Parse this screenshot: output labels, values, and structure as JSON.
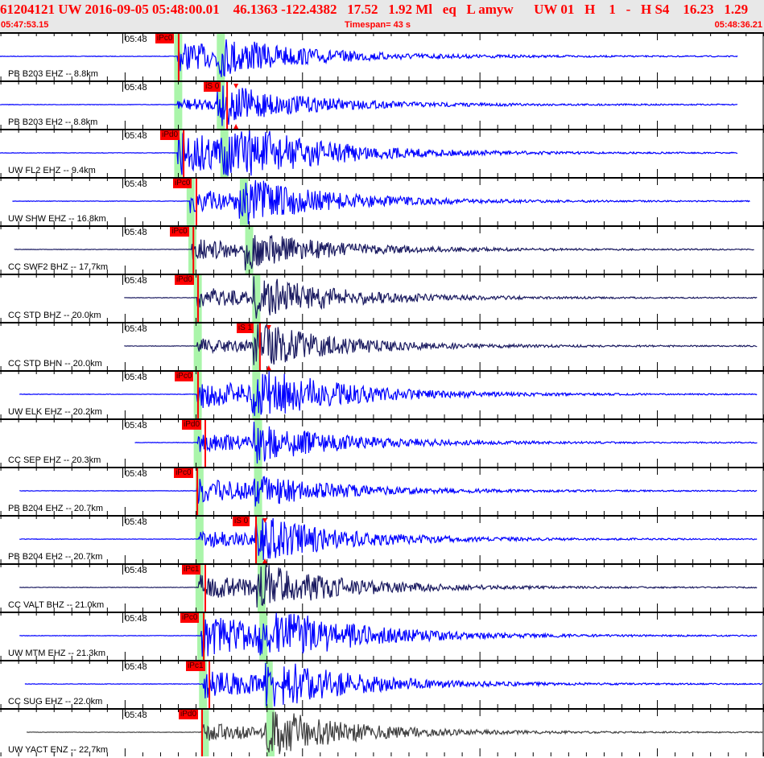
{
  "header": {
    "title": "61204121 UW 2016-09-05 05:48:00.01    46.1363 -122.4382   17.52   1.92 Ml   eq   L amyw      UW 01   H    1   -   H S4    16.23   1.29",
    "start_time": "05:47:53.15",
    "timespan": "Timespan=  43 s",
    "end_time": "05:48:36.21"
  },
  "axis": {
    "window_start_s": 0,
    "window_length_s": 43.06,
    "minute_label": "05:48",
    "minute_label_time_s": 6.9
  },
  "colors": {
    "header_text": "#ff0000",
    "pick": "#ff0000",
    "predicted_band": "#aaf5aa",
    "blue": "#0000ff",
    "navy": "#1a1a60",
    "gray": "#404040"
  },
  "traces": [
    {
      "label": "PB B203 EHZ -- 8.8km",
      "pick": "iPc0",
      "pick_s": 10.07,
      "p_band_s": 10.0,
      "s_band_s": 12.4,
      "data_start_s": 0,
      "data_end_s": 41.6,
      "color": "blue",
      "amp": 0.6,
      "s_amp": 0.5
    },
    {
      "label": "PB B203 EH2 -- 8.8km",
      "pick": "iS 0",
      "pick_s": 12.8,
      "p_band_s": 10.0,
      "s_band_s": 12.4,
      "data_start_s": 0,
      "data_end_s": 41.6,
      "color": "blue",
      "amp": 0.2,
      "s_amp": 0.8
    },
    {
      "label": "UW FL2 EHZ -- 9.4km",
      "pick": "iPd0",
      "pick_s": 10.35,
      "p_band_s": 10.0,
      "s_band_s": 12.6,
      "data_start_s": 0,
      "data_end_s": 41.6,
      "color": "blue",
      "amp": 1.0,
      "s_amp": 1.0
    },
    {
      "label": "UW SHW EHZ -- 16.8km",
      "pick": "iPc0",
      "pick_s": 11.07,
      "p_band_s": 10.7,
      "s_band_s": 13.7,
      "data_start_s": 0.7,
      "data_end_s": 42.3,
      "color": "blue",
      "amp": 0.5,
      "s_amp": 0.8
    },
    {
      "label": "CC SWF2 BHZ -- 17.7km",
      "pick": "iPc0",
      "pick_s": 10.9,
      "p_band_s": 10.8,
      "s_band_s": 14.0,
      "data_start_s": 0.8,
      "data_end_s": 42.5,
      "color": "navy",
      "amp": 0.4,
      "s_amp": 0.6
    },
    {
      "label": "CC STD BHZ -- 20.0km",
      "pick": "iPd0",
      "pick_s": 11.16,
      "p_band_s": 11.1,
      "s_band_s": 14.4,
      "data_start_s": 7.0,
      "data_end_s": 42.7,
      "color": "navy",
      "amp": 0.4,
      "s_amp": 0.8
    },
    {
      "label": "CC STD BHN -- 20.0km",
      "pick": "iS 1",
      "pick_s": 14.65,
      "p_band_s": 11.1,
      "s_band_s": 14.4,
      "data_start_s": 7.0,
      "data_end_s": 42.7,
      "color": "navy",
      "amp": 0.25,
      "s_amp": 0.9
    },
    {
      "label": "UW ELK EHZ -- 20.2km",
      "pick": "iPc0",
      "pick_s": 11.16,
      "p_band_s": 11.1,
      "s_band_s": 14.4,
      "data_start_s": 1.1,
      "data_end_s": 42.7,
      "color": "blue",
      "amp": 0.6,
      "s_amp": 1.0
    },
    {
      "label": "CC SEP EHZ -- 20.3km",
      "pick": "iPd0",
      "pick_s": 11.57,
      "p_band_s": 11.1,
      "s_band_s": 14.5,
      "data_start_s": 7.6,
      "data_end_s": 42.7,
      "color": "blue",
      "amp": 0.35,
      "s_amp": 0.7
    },
    {
      "label": "PB B204 EHZ -- 20.7km",
      "pick": "iPc0",
      "pick_s": 11.12,
      "p_band_s": 11.2,
      "s_band_s": 14.5,
      "data_start_s": 1.1,
      "data_end_s": 42.7,
      "color": "blue",
      "amp": 0.5,
      "s_amp": 0.4
    },
    {
      "label": "PB B204 EH2 -- 20.7km",
      "pick": "iS 0",
      "pick_s": 14.43,
      "p_band_s": 11.2,
      "s_band_s": 14.6,
      "data_start_s": 1.1,
      "data_end_s": 42.7,
      "color": "blue",
      "amp": 0.3,
      "s_amp": 0.9
    },
    {
      "label": "CC VALT BHZ -- 21.0km",
      "pick": "iPc1",
      "pick_s": 11.57,
      "p_band_s": 11.2,
      "s_band_s": 14.7,
      "data_start_s": 1.1,
      "data_end_s": 42.7,
      "color": "navy",
      "amp": 0.5,
      "s_amp": 0.8
    },
    {
      "label": "UW MTM EHZ -- 21.3km",
      "pick": "iPc0",
      "pick_s": 11.48,
      "p_band_s": 11.3,
      "s_band_s": 14.8,
      "data_start_s": 1.1,
      "data_end_s": 42.7,
      "color": "blue",
      "amp": 0.9,
      "s_amp": 1.0
    },
    {
      "label": "CC SUG EHZ -- 22.0km",
      "pick": "iPc1",
      "pick_s": 11.8,
      "p_band_s": 11.4,
      "s_band_s": 15.1,
      "data_start_s": 1.4,
      "data_end_s": 43.0,
      "color": "blue",
      "amp": 0.6,
      "s_amp": 0.9
    },
    {
      "label": "UW YACT ENZ -- 22.7km",
      "pick": "iPd0",
      "pick_s": 11.39,
      "p_band_s": 11.5,
      "s_band_s": 15.2,
      "data_start_s": 1.5,
      "data_end_s": 43.0,
      "color": "gray",
      "amp": 0.35,
      "s_amp": 0.9
    }
  ]
}
